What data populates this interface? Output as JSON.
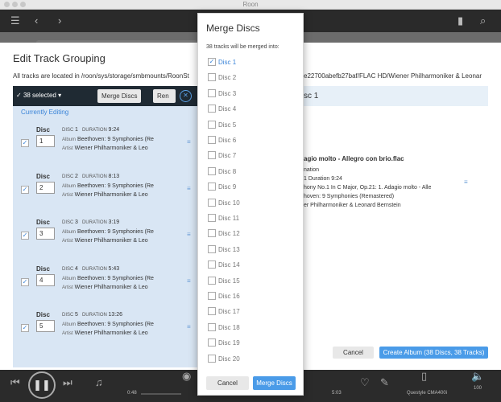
{
  "window": {
    "title": "Roon"
  },
  "edit_track_grouping": {
    "title": "Edit Track Grouping",
    "path_left": "All tracks are located in /roon/sys/storage/smbmounts/RoonSt",
    "path_right": "e22700abefb27baf/FLAC HD/Wiener Philharmoniker & Leonar",
    "toolbar": {
      "selected_label": "38 selected ▾",
      "selected_check": "✓",
      "merge_label": "Merge Discs",
      "rename_label": "Ren",
      "close_glyph": "✕"
    },
    "currently_editing": "Currently Editing",
    "disc_label": "Disc",
    "disc_prefix": "DISC",
    "duration_prefix": "DURATION",
    "album_prefix": "Album",
    "artist_prefix": "Artist",
    "discs": [
      {
        "num": "1",
        "input": "1",
        "duration": "9:24",
        "album": "Beethoven: 9 Symphonies (Re",
        "artist": "Wiener Philharmoniker & Leo"
      },
      {
        "num": "2",
        "input": "2",
        "duration": "8:13",
        "album": "Beethoven: 9 Symphonies (Re",
        "artist": "Wiener Philharmoniker & Leo"
      },
      {
        "num": "3",
        "input": "3",
        "duration": "3:19",
        "album": "Beethoven: 9 Symphonies (Re",
        "artist": "Wiener Philharmoniker & Leo"
      },
      {
        "num": "4",
        "input": "4",
        "duration": "5:43",
        "album": "Beethoven: 9 Symphonies (Re",
        "artist": "Wiener Philharmoniker & Leo"
      },
      {
        "num": "5",
        "input": "5",
        "duration": "13:26",
        "album": "Beethoven: 9 Symphonies (Re",
        "artist": "Wiener Philharmoniker & Leo"
      }
    ],
    "right": {
      "heading": "sc 1",
      "filename": "agio molto - Allegro con brio.flac",
      "line1": "nation",
      "line2": "1  Duration  9:24",
      "line3": "hony No.1 In C Major, Op.21: 1. Adagio molto - Alle",
      "line4": "hoven: 9 Symphonies (Remastered)",
      "line5": "er Philharmoniker & Leonard Bernstein"
    },
    "cancel_label": "Cancel",
    "create_label": "Create Album (38 Discs, 38 Tracks)"
  },
  "merge_discs": {
    "title": "Merge Discs",
    "info": "38 tracks will be merged into:",
    "options": [
      {
        "label": "Disc 1",
        "checked": true
      },
      {
        "label": "Disc 2",
        "checked": false
      },
      {
        "label": "Disc 3",
        "checked": false
      },
      {
        "label": "Disc 4",
        "checked": false
      },
      {
        "label": "Disc 5",
        "checked": false
      },
      {
        "label": "Disc 6",
        "checked": false
      },
      {
        "label": "Disc 7",
        "checked": false
      },
      {
        "label": "Disc 8",
        "checked": false
      },
      {
        "label": "Disc 9",
        "checked": false
      },
      {
        "label": "Disc 10",
        "checked": false
      },
      {
        "label": "Disc 11",
        "checked": false
      },
      {
        "label": "Disc 12",
        "checked": false
      },
      {
        "label": "Disc 13",
        "checked": false
      },
      {
        "label": "Disc 14",
        "checked": false
      },
      {
        "label": "Disc 15",
        "checked": false
      },
      {
        "label": "Disc 16",
        "checked": false
      },
      {
        "label": "Disc 17",
        "checked": false
      },
      {
        "label": "Disc 18",
        "checked": false
      },
      {
        "label": "Disc 19",
        "checked": false
      },
      {
        "label": "Disc 20",
        "checked": false
      }
    ],
    "cancel_label": "Cancel",
    "merge_label": "Merge Discs"
  },
  "player": {
    "elapsed": "0:48",
    "total": "5:03",
    "zone": "Questyle CMA400i",
    "volume": "100"
  },
  "colors": {
    "accent": "#4a9be8",
    "list_bg": "#d9e6f4",
    "toolbar_bg": "#1f2a33"
  }
}
